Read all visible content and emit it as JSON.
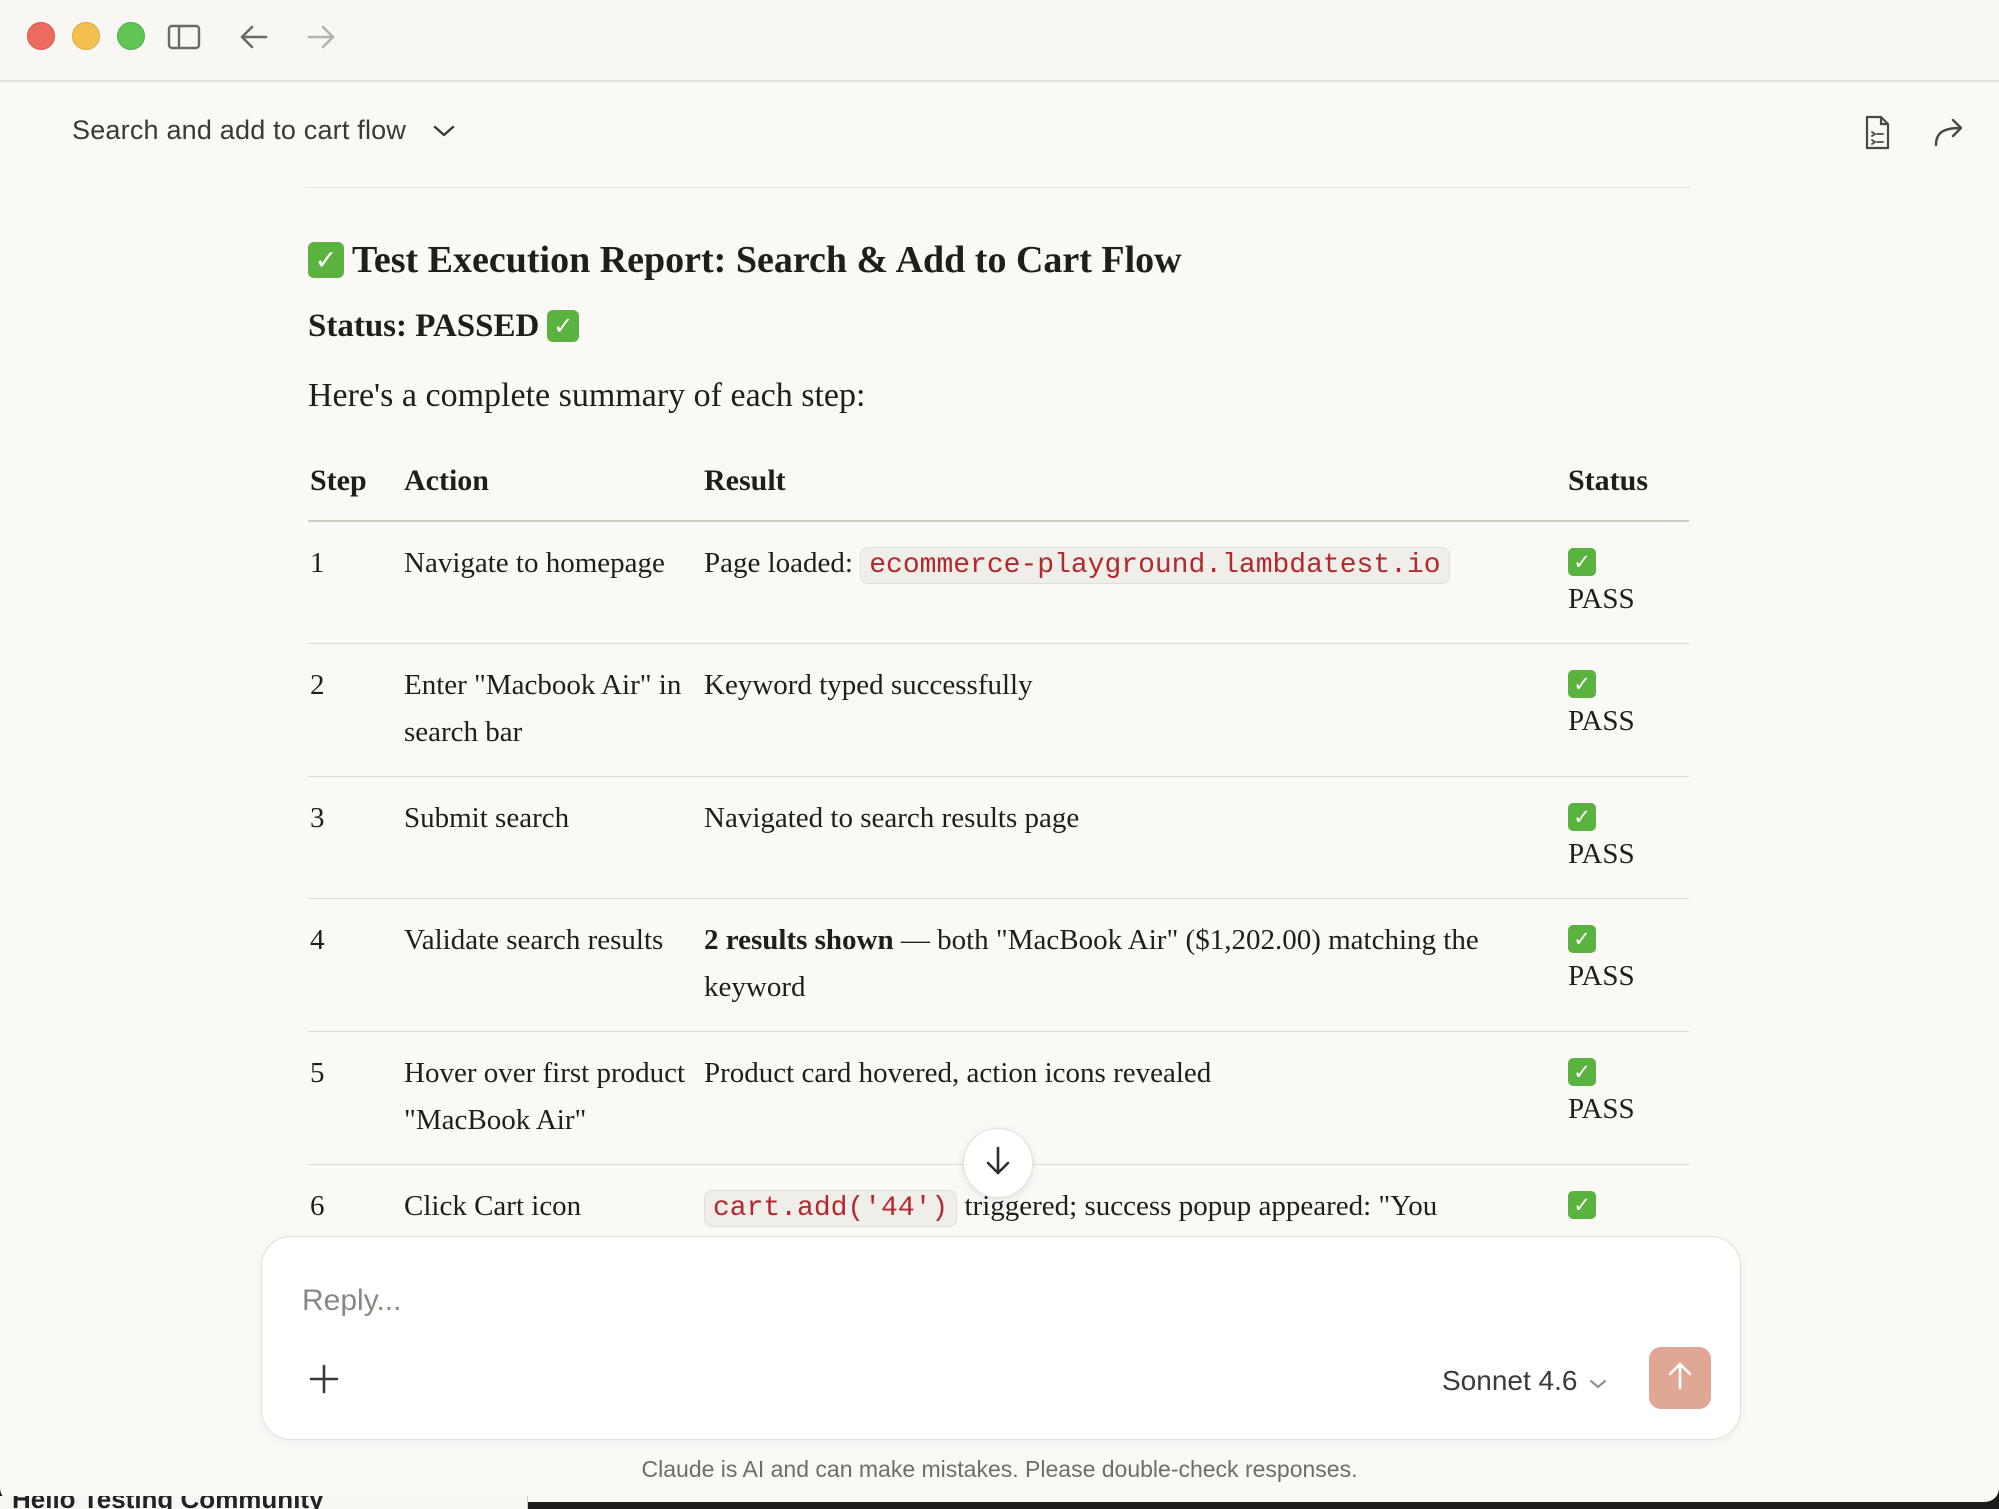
{
  "conversation": {
    "title": "Search and add to cart flow"
  },
  "report": {
    "heading": "Test Execution Report: Search & Add to Cart Flow",
    "status_label": "Status: PASSED",
    "intro": "Here's a complete summary of each step:",
    "columns": [
      "Step",
      "Action",
      "Result",
      "Status"
    ],
    "rows": [
      {
        "step": "1",
        "action": "Navigate to homepage",
        "result_prefix": "Page loaded:",
        "result_code": "ecommerce-playground.lambdatest.io",
        "status": "PASS"
      },
      {
        "step": "2",
        "action": "Enter \"Macbook Air\" in search bar",
        "result": "Keyword typed successfully",
        "status": "PASS"
      },
      {
        "step": "3",
        "action": "Submit search",
        "result": "Navigated to search results page",
        "status": "PASS"
      },
      {
        "step": "4",
        "action": "Validate search results",
        "result_bold": "2 results shown",
        "result_rest": " — both \"MacBook Air\" ($1,202.00) matching the keyword",
        "status": "PASS"
      },
      {
        "step": "5",
        "action": "Hover over first product \"MacBook Air\"",
        "result": "Product card hovered, action icons revealed",
        "status": "PASS"
      },
      {
        "step": "6",
        "action": "Click Cart icon",
        "result_code": "cart.add('44')",
        "result_rest": " triggered; success popup appeared: \"You",
        "status": ""
      }
    ]
  },
  "composer": {
    "placeholder": "Reply...",
    "model": "Sonnet 4.6"
  },
  "disclaimer": "Claude is AI and can make mistakes. Please double-check responses.",
  "background_window_text": "Hello Testing Community",
  "colors": {
    "accent_send": "#e0a795",
    "check_green": "#5ab33e",
    "code_red": "#b3282d"
  }
}
